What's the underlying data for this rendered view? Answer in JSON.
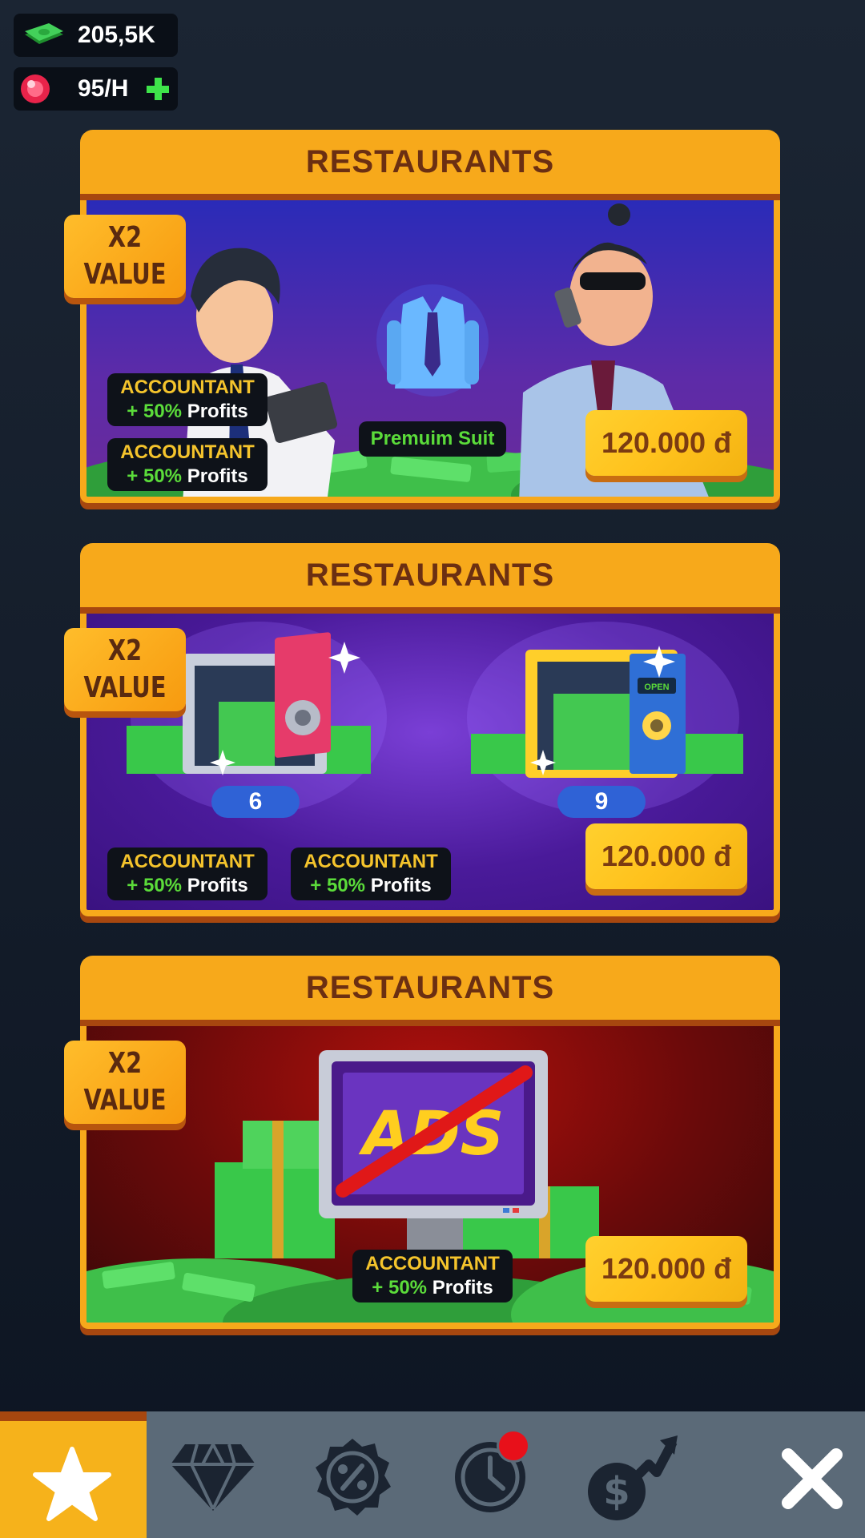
{
  "currency": {
    "cash": "205,5K",
    "gems_rate": "95/H"
  },
  "panels": [
    {
      "title": "RESTAURANTS",
      "badge": {
        "line1": "X2",
        "line2": "VALUE"
      },
      "perks": [
        {
          "title": "ACCOUNTANT",
          "bonus": "+ 50%",
          "suffix": "Profits"
        },
        {
          "title": "ACCOUNTANT",
          "bonus": "+ 50%",
          "suffix": "Profits"
        }
      ],
      "item_label": "Premuim Suit",
      "price": "120.000 đ"
    },
    {
      "title": "RESTAURANTS",
      "badge": {
        "line1": "X2",
        "line2": "VALUE"
      },
      "safes": [
        "6",
        "9"
      ],
      "safe_sign": "OPEN",
      "perks": [
        {
          "title": "ACCOUNTANT",
          "bonus": "+ 50%",
          "suffix": "Profits"
        },
        {
          "title": "ACCOUNTANT",
          "bonus": "+ 50%",
          "suffix": "Profits"
        }
      ],
      "price": "120.000 đ"
    },
    {
      "title": "RESTAURANTS",
      "badge": {
        "line1": "X2",
        "line2": "VALUE"
      },
      "ads_text": "ADS",
      "perks": [
        {
          "title": "ACCOUNTANT",
          "bonus": "+ 50%",
          "suffix": "Profits"
        }
      ],
      "price": "120.000 đ"
    }
  ],
  "nav": {
    "tabs": [
      {
        "icon": "star-icon",
        "active": true
      },
      {
        "icon": "diamond-icon",
        "active": false
      },
      {
        "icon": "discount-badge-icon",
        "active": false
      },
      {
        "icon": "clock-icon",
        "active": false,
        "notification": true
      },
      {
        "icon": "money-growth-icon",
        "active": false
      },
      {
        "icon": "close-icon",
        "active": false
      }
    ]
  },
  "colors": {
    "accent": "#f7a91b",
    "frame_dark": "#a7470f",
    "title_text": "#6b2f12",
    "price_bg": "#ffc21d",
    "perk_gold": "#f5c42c",
    "perk_green": "#5bdc3a",
    "nav_bg": "#5b6a78"
  }
}
